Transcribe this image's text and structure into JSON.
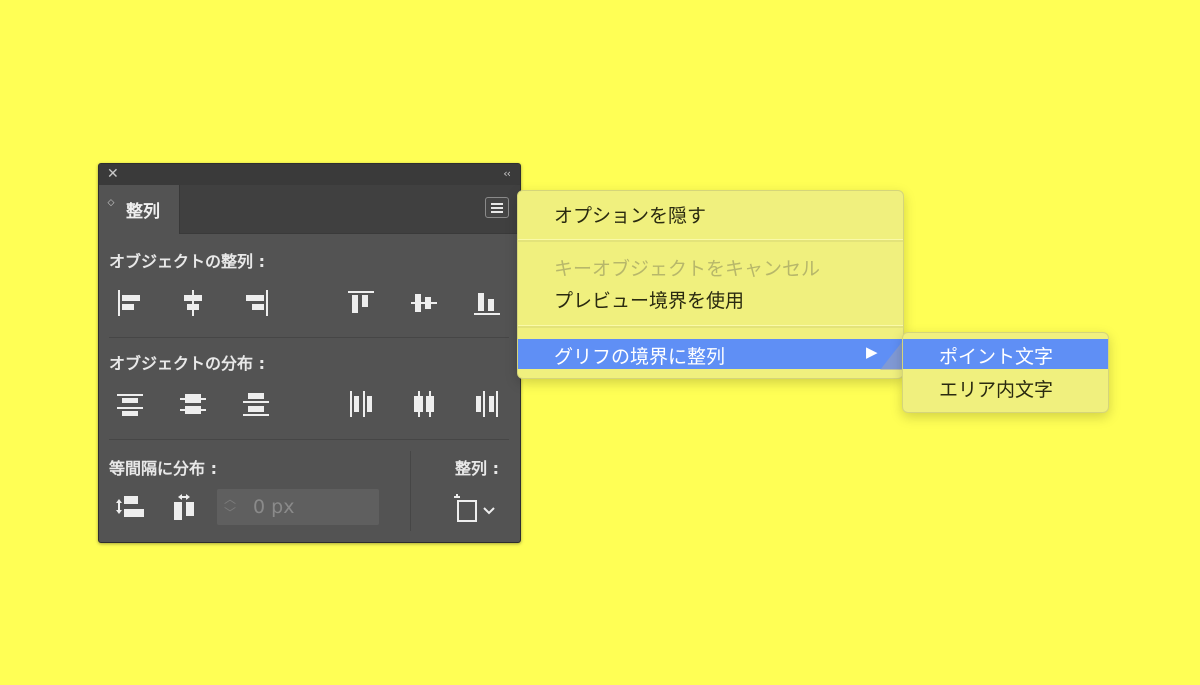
{
  "panel": {
    "tab_label": "整列",
    "section_align_objects": "オブジェクトの整列 :",
    "section_distribute_objects": "オブジェクトの分布 :",
    "section_distribute_spacing": "等間隔に分布 :",
    "section_align_to": "整列 :",
    "spacing_placeholder": "0 px"
  },
  "menu": {
    "items": [
      {
        "label": "オプションを隠す",
        "state": "enabled"
      },
      {
        "label": "キーオブジェクトをキャンセル",
        "state": "disabled"
      },
      {
        "label": "プレビュー境界を使用",
        "state": "enabled"
      },
      {
        "label": "グリフの境界に整列",
        "state": "highlighted",
        "submenu_arrow": "▶"
      }
    ]
  },
  "submenu": {
    "items": [
      {
        "label": "ポイント文字",
        "state": "highlighted"
      },
      {
        "label": "エリア内文字",
        "state": "enabled"
      }
    ]
  },
  "colors": {
    "background": "#ffff55",
    "panel": "#535353",
    "menu": "#f0f07e",
    "highlight": "#5f8ff5"
  }
}
